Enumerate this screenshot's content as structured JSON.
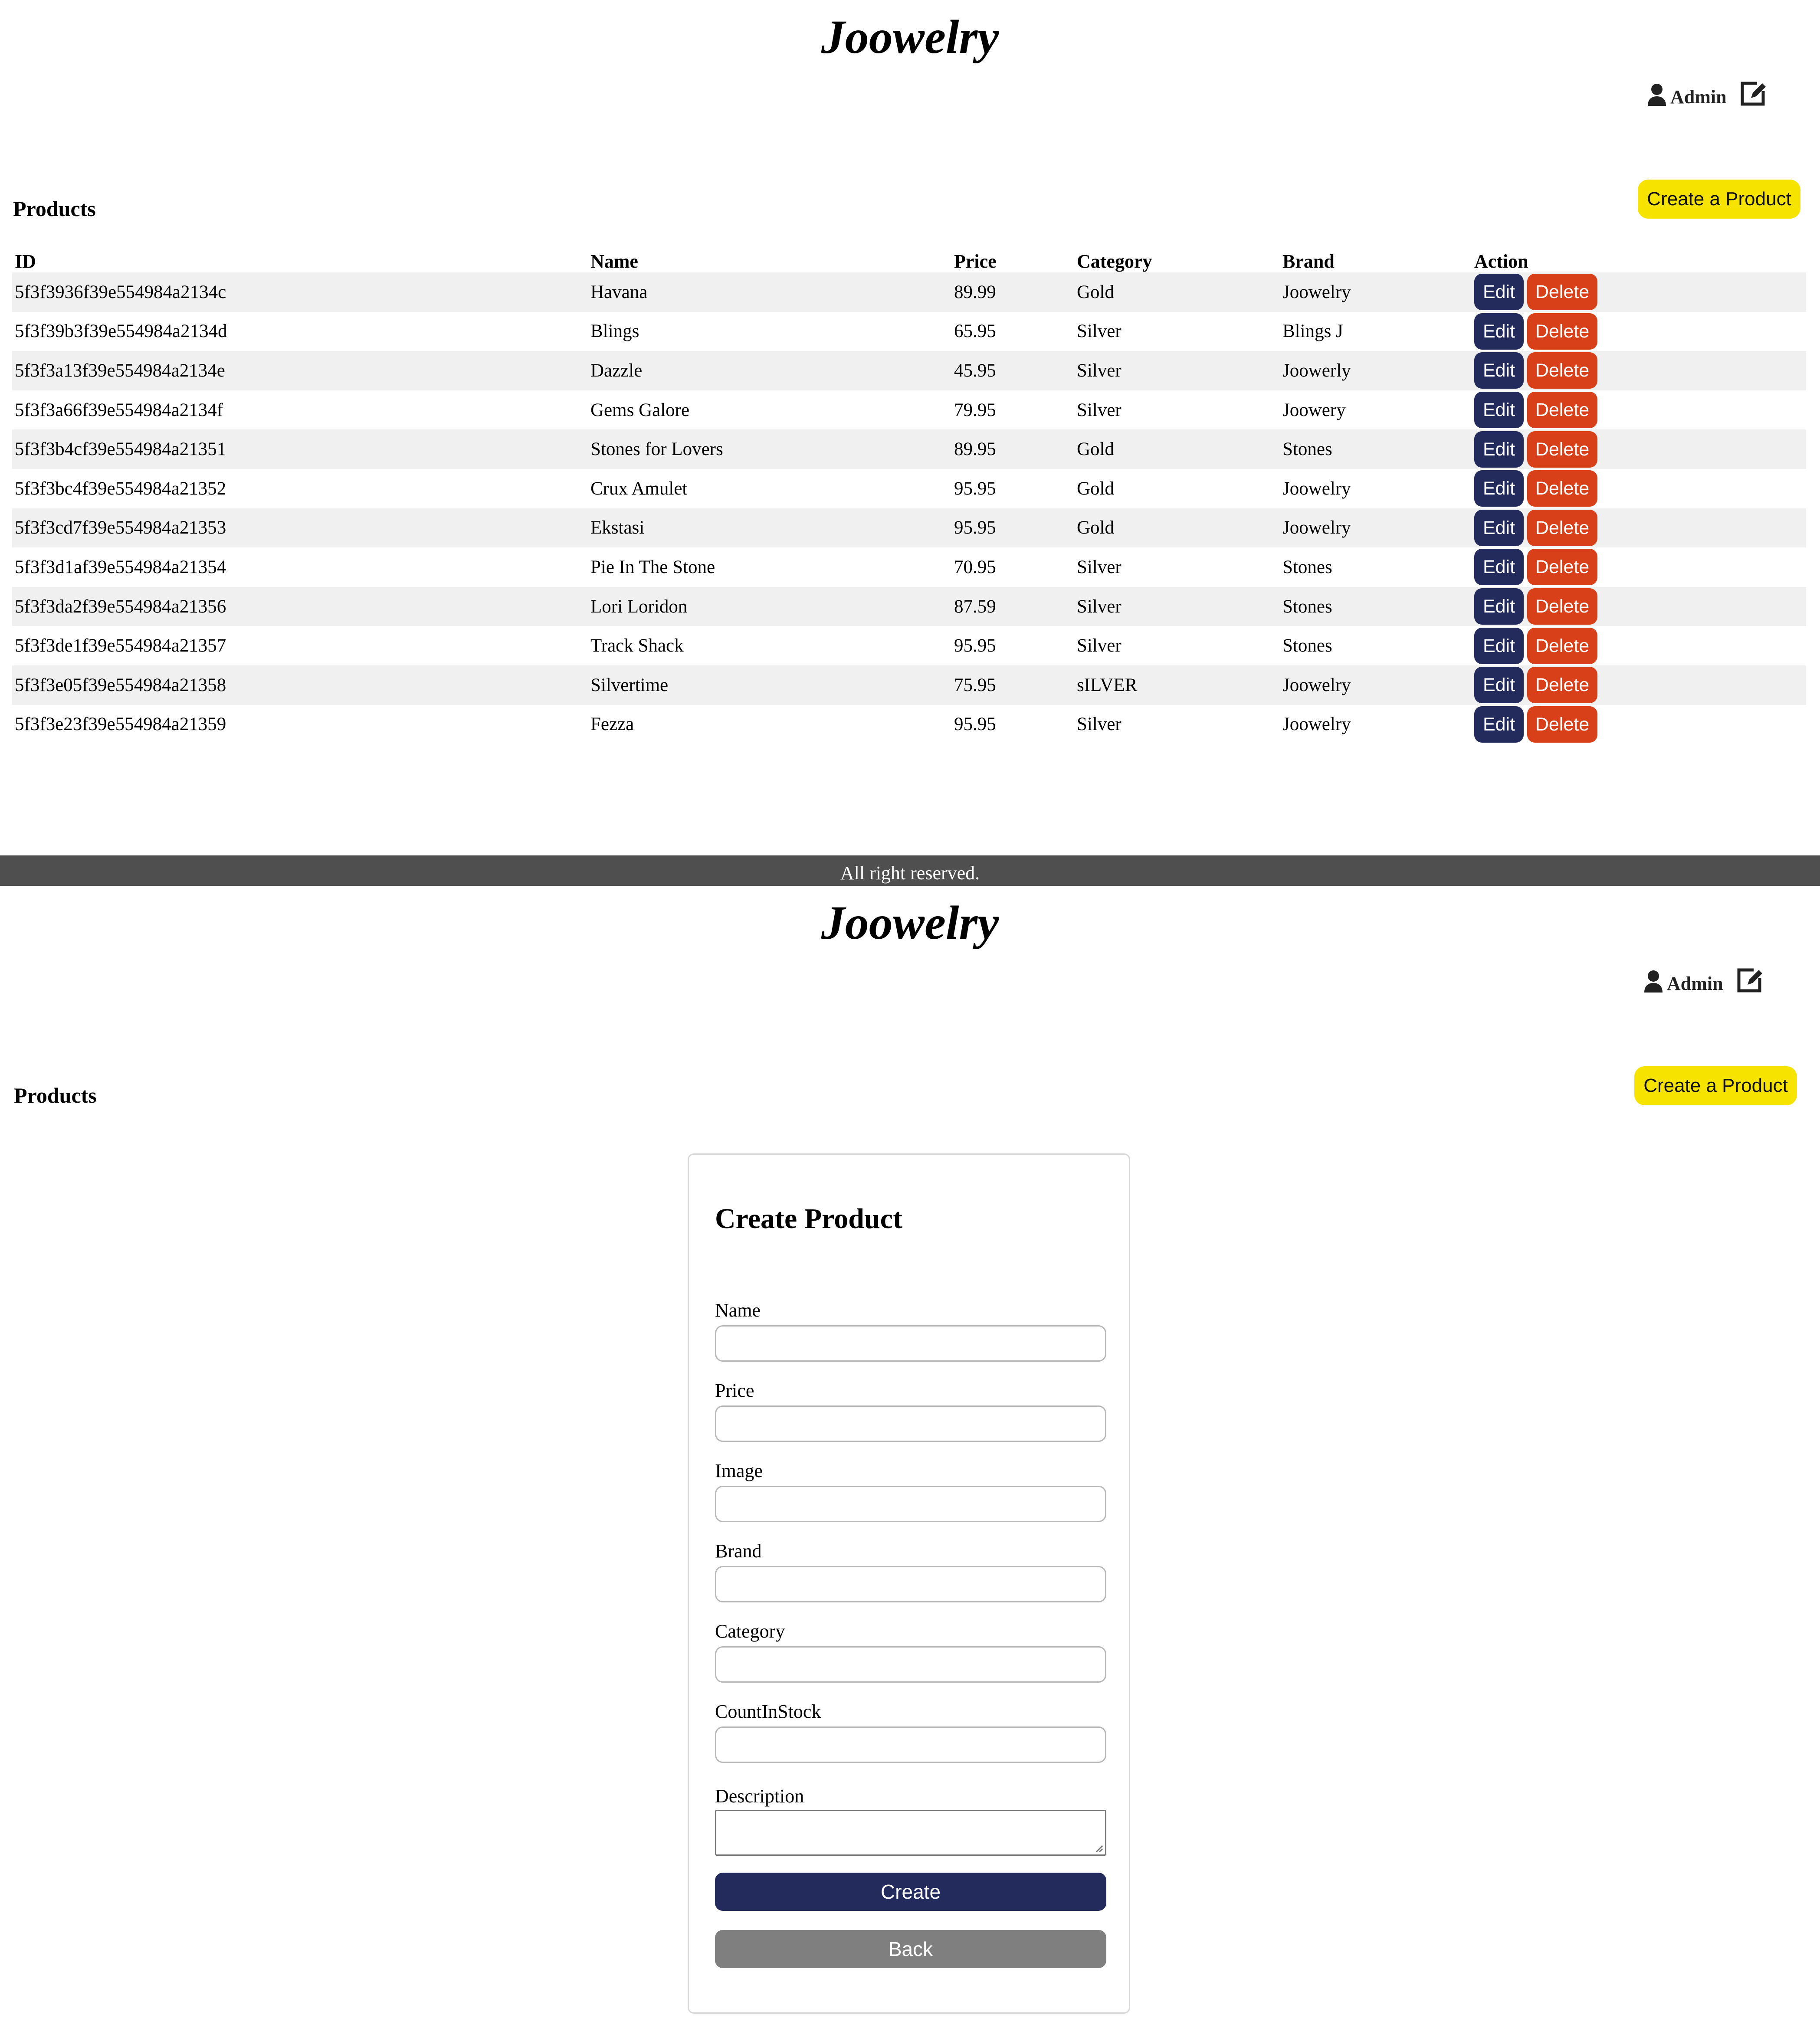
{
  "app": {
    "brand": "Joowelry",
    "user_label": "Admin"
  },
  "list_view": {
    "section_title": "Products",
    "create_button": "Create a Product",
    "columns": [
      "ID",
      "Name",
      "Price",
      "Category",
      "Brand",
      "Action"
    ],
    "rows": [
      {
        "id": "5f3f3936f39e554984a2134c",
        "name": "Havana",
        "price": "89.99",
        "category": "Gold",
        "brand": "Joowelry"
      },
      {
        "id": "5f3f39b3f39e554984a2134d",
        "name": "Blings",
        "price": "65.95",
        "category": "Silver",
        "brand": "Blings J"
      },
      {
        "id": "5f3f3a13f39e554984a2134e",
        "name": "Dazzle",
        "price": "45.95",
        "category": "Silver",
        "brand": "Joowerly"
      },
      {
        "id": "5f3f3a66f39e554984a2134f",
        "name": "Gems Galore",
        "price": "79.95",
        "category": "Silver",
        "brand": "Joowery"
      },
      {
        "id": "5f3f3b4cf39e554984a21351",
        "name": "Stones for Lovers",
        "price": "89.95",
        "category": "Gold",
        "brand": "Stones"
      },
      {
        "id": "5f3f3bc4f39e554984a21352",
        "name": "Crux Amulet",
        "price": "95.95",
        "category": "Gold",
        "brand": "Joowelry"
      },
      {
        "id": "5f3f3cd7f39e554984a21353",
        "name": "Ekstasi",
        "price": "95.95",
        "category": "Gold",
        "brand": "Joowelry"
      },
      {
        "id": "5f3f3d1af39e554984a21354",
        "name": "Pie In The Stone",
        "price": "70.95",
        "category": "Silver",
        "brand": "Stones"
      },
      {
        "id": "5f3f3da2f39e554984a21356",
        "name": "Lori Loridon",
        "price": "87.59",
        "category": "Silver",
        "brand": "Stones"
      },
      {
        "id": "5f3f3de1f39e554984a21357",
        "name": "Track Shack",
        "price": "95.95",
        "category": "Silver",
        "brand": "Stones"
      },
      {
        "id": "5f3f3e05f39e554984a21358",
        "name": "Silvertime",
        "price": "75.95",
        "category": "sILVER",
        "brand": "Joowelry"
      },
      {
        "id": "5f3f3e23f39e554984a21359",
        "name": "Fezza",
        "price": "95.95",
        "category": "Silver",
        "brand": "Joowelry"
      }
    ],
    "edit_label": "Edit",
    "delete_label": "Delete"
  },
  "footer": {
    "text": "All right reserved."
  },
  "create_view": {
    "section_title": "Products",
    "create_button": "Create a Product",
    "form_title": "Create Product",
    "fields": [
      {
        "label": "Name",
        "value": ""
      },
      {
        "label": "Price",
        "value": ""
      },
      {
        "label": "Image",
        "value": ""
      },
      {
        "label": "Brand",
        "value": ""
      },
      {
        "label": "Category",
        "value": ""
      },
      {
        "label": "CountInStock",
        "value": ""
      },
      {
        "label": "Description",
        "value": ""
      }
    ],
    "submit_label": "Create",
    "back_label": "Back"
  },
  "colors": {
    "create_product_button": "#f7e300",
    "edit_button": "#232a5c",
    "delete_button": "#d8401a",
    "footer_bar": "#4f4f4f",
    "back_button": "#7f7f7f",
    "row_stripe": "#f0f0f0"
  },
  "icons": [
    "user-icon",
    "edit-profile-icon"
  ]
}
